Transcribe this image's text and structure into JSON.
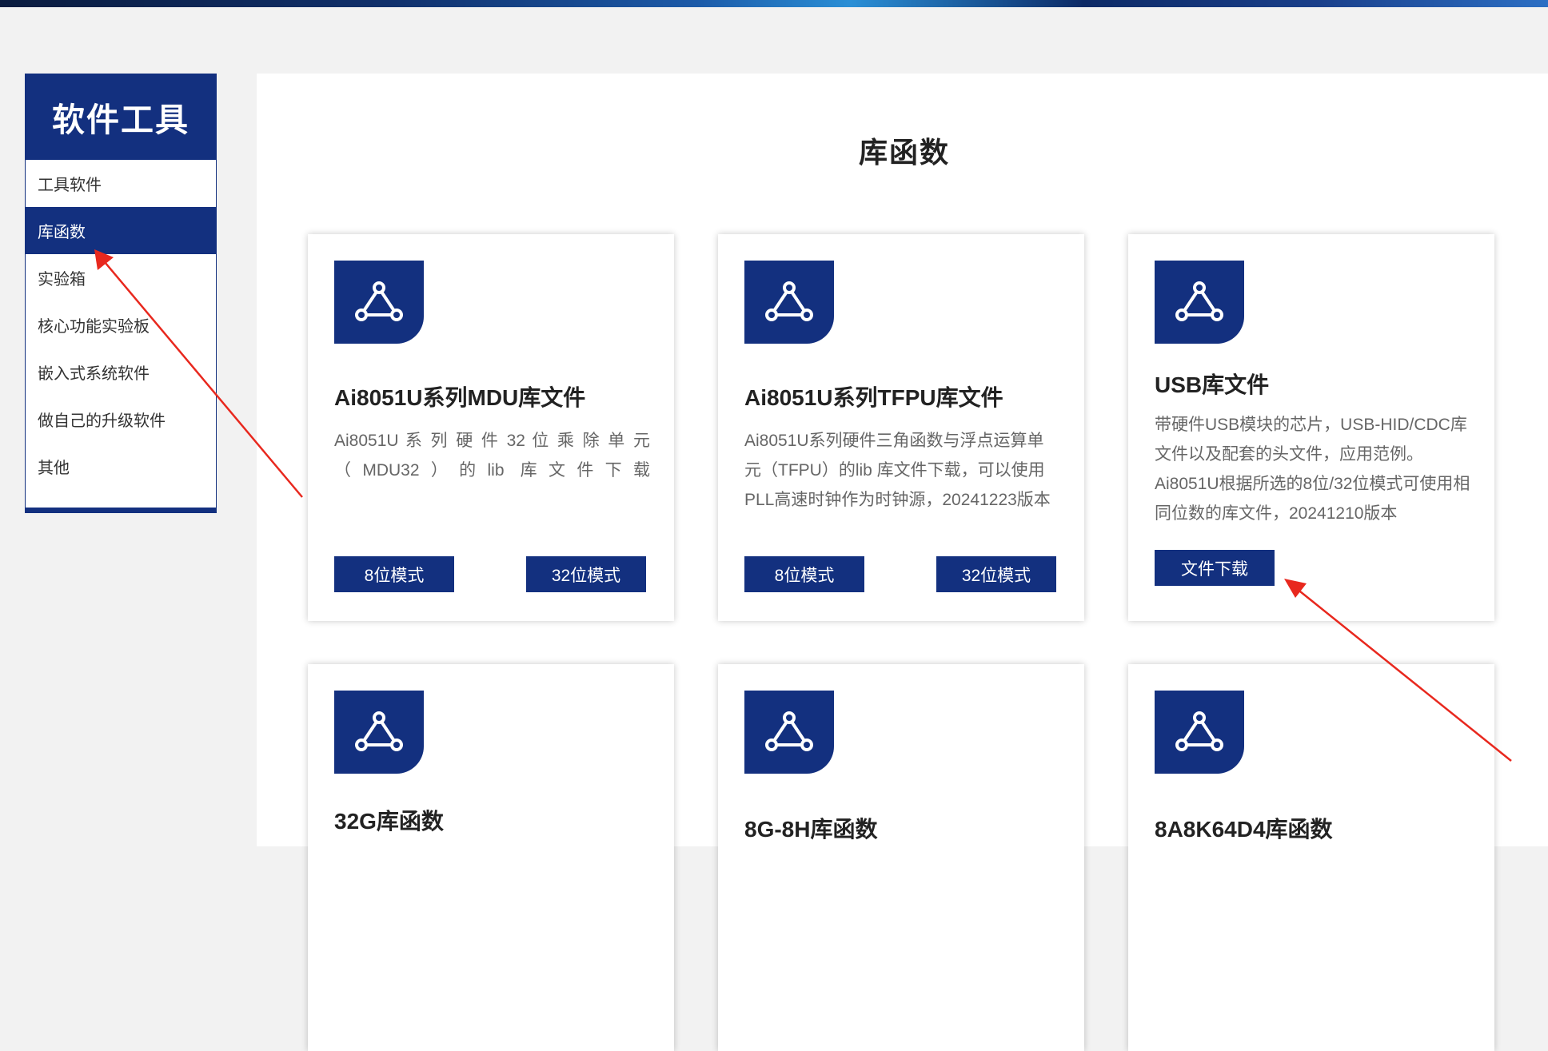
{
  "sidebar": {
    "title": "软件工具",
    "items": [
      {
        "label": "工具软件",
        "active": false
      },
      {
        "label": "库函数",
        "active": true
      },
      {
        "label": "实验箱",
        "active": false
      },
      {
        "label": "核心功能实验板",
        "active": false
      },
      {
        "label": "嵌入式系统软件",
        "active": false
      },
      {
        "label": "做自己的升级软件",
        "active": false
      },
      {
        "label": "其他",
        "active": false
      }
    ]
  },
  "main": {
    "title": "库函数",
    "cards": [
      {
        "title": "Ai8051U系列MDU库文件",
        "desc": "Ai8051U 系 列 硬 件 32 位 乘 除 单 元 （MDU32）的lib 库文件下载",
        "buttons": [
          "8位模式",
          "32位模式"
        ]
      },
      {
        "title": "Ai8051U系列TFPU库文件",
        "desc": "Ai8051U系列硬件三角函数与浮点运算单元（TFPU）的lib 库文件下载，可以使用PLL高速时钟作为时钟源，20241223版本",
        "buttons": [
          "8位模式",
          "32位模式"
        ]
      },
      {
        "title": "USB库文件",
        "desc": "带硬件USB模块的芯片，USB-HID/CDC库文件以及配套的头文件，应用范例。Ai8051U根据所选的8位/32位模式可使用相同位数的库文件，20241210版本",
        "buttons": [
          "文件下载"
        ]
      },
      {
        "title": "32G库函数"
      },
      {
        "title": "8G-8H库函数"
      },
      {
        "title": "8A8K64D4库函数"
      }
    ]
  },
  "colors": {
    "primary": "#13307f",
    "annotation_arrow": "#e8281e"
  }
}
